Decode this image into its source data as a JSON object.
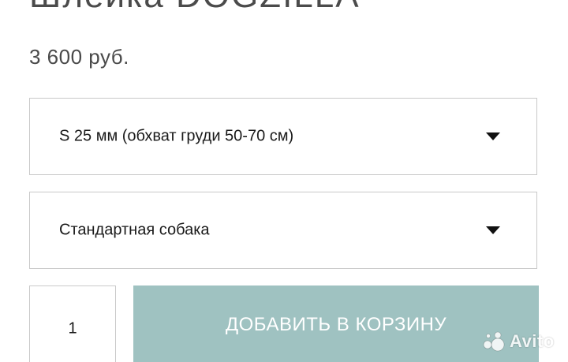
{
  "product": {
    "title": "Шлейка DOGZILLA",
    "price": "3 600 руб."
  },
  "options": {
    "size_selected": "S 25 мм (обхват груди 50-70 см)",
    "type_selected": "Стандартная собака"
  },
  "cart": {
    "quantity": "1",
    "add_button_label": "ДОБАВИТЬ В КОРЗИНУ"
  },
  "watermark": {
    "text": "Avito",
    "icon": "avito-logo-icon"
  },
  "colors": {
    "add_button_bg": "#9fc2c1",
    "border": "#c9c9c9",
    "text": "#1a1a1a"
  }
}
